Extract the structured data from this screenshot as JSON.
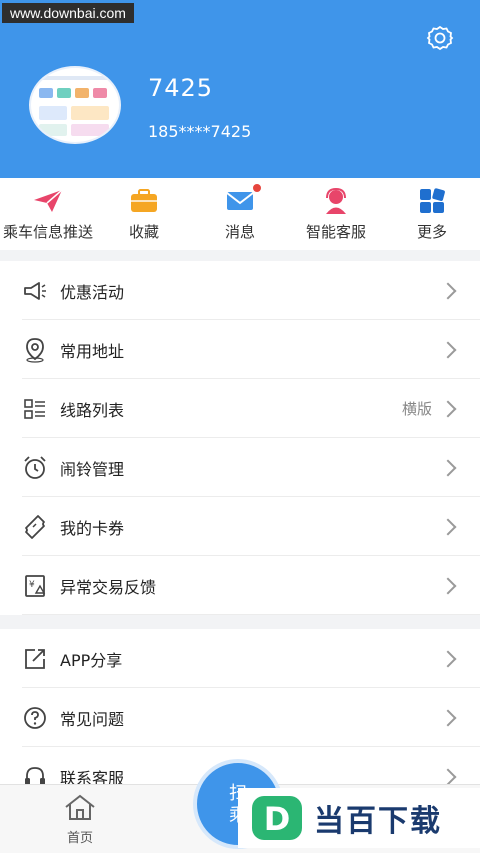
{
  "watermark": "www.downbai.com",
  "profile": {
    "name": "7425",
    "phone": "185****7425"
  },
  "quick_actions": [
    {
      "label": "乘车信息推送",
      "icon": "paper-plane-icon"
    },
    {
      "label": "收藏",
      "icon": "briefcase-icon"
    },
    {
      "label": "消息",
      "icon": "envelope-icon",
      "badge": true
    },
    {
      "label": "智能客服",
      "icon": "agent-icon"
    },
    {
      "label": "更多",
      "icon": "grid-icon"
    }
  ],
  "menu_group1": [
    {
      "label": "优惠活动",
      "icon": "megaphone-icon",
      "extra": ""
    },
    {
      "label": "常用地址",
      "icon": "location-pin-icon",
      "extra": ""
    },
    {
      "label": "线路列表",
      "icon": "list-icon",
      "extra": "横版"
    },
    {
      "label": "闹铃管理",
      "icon": "alarm-clock-icon",
      "extra": ""
    },
    {
      "label": "我的卡券",
      "icon": "ticket-icon",
      "extra": ""
    },
    {
      "label": "异常交易反馈",
      "icon": "feedback-icon",
      "extra": ""
    }
  ],
  "menu_group2": [
    {
      "label": "APP分享",
      "icon": "share-icon"
    },
    {
      "label": "常见问题",
      "icon": "question-icon"
    },
    {
      "label": "联系客服",
      "icon": "headset-icon"
    }
  ],
  "tabbar": {
    "home_label": "首页",
    "scan_label_1": "扫",
    "scan_label_2": "乘"
  },
  "brand": {
    "text": "当百下载",
    "logo_letter": "D"
  },
  "colors": {
    "primary": "#3f95ea",
    "badge": "#e6453d",
    "send_icon": "#e8456a",
    "fav_icon": "#f5a623",
    "more_icon": "#1f6fcf"
  }
}
